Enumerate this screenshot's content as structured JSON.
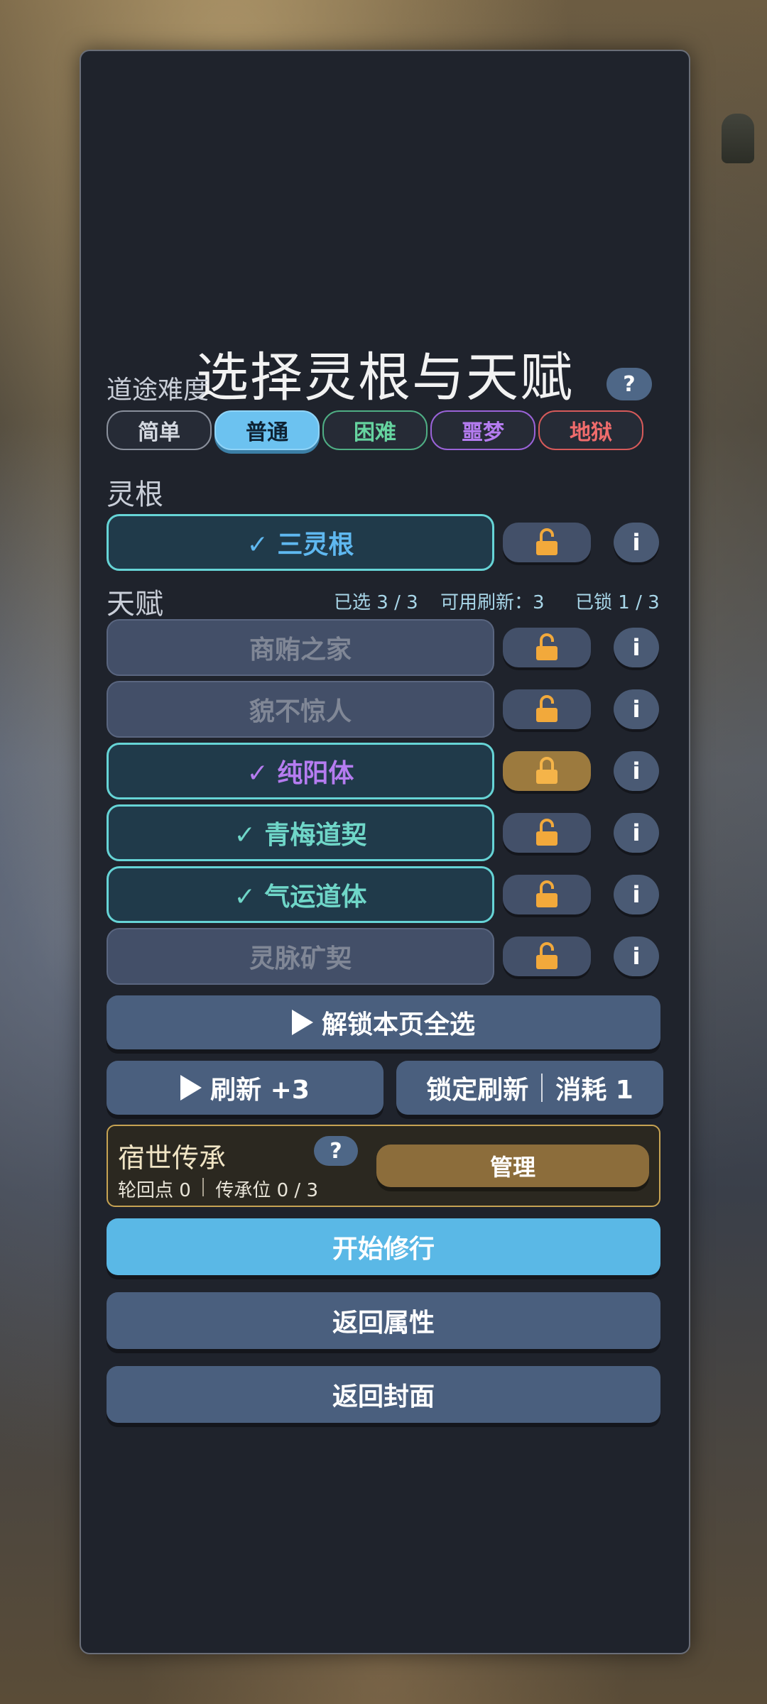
{
  "title": "选择灵根与天赋",
  "difficulty": {
    "label": "道途难度",
    "help": "?",
    "options": [
      {
        "label": "简单",
        "color": "#d4d8e0"
      },
      {
        "label": "普通",
        "color": "#0e2233"
      },
      {
        "label": "困难",
        "color": "#66d4a0"
      },
      {
        "label": "噩梦",
        "color": "#b57cf0"
      },
      {
        "label": "地狱",
        "color": "#f06c6c"
      }
    ],
    "selected": "普通"
  },
  "root": {
    "label": "灵根",
    "item": {
      "label": "✓ 三灵根",
      "selected": true,
      "locked": false,
      "color": "#5fb8f0"
    }
  },
  "talents": {
    "label": "天赋",
    "selected_count": "已选 3 / 3",
    "refresh_available": "可用刷新：3",
    "locked_count": "已锁 1 / 3",
    "items": [
      {
        "label": "商贿之家",
        "selected": false,
        "locked": false
      },
      {
        "label": "貌不惊人",
        "selected": false,
        "locked": false
      },
      {
        "label": "✓ 纯阳体",
        "selected": true,
        "locked": true,
        "color": "#b57cf0"
      },
      {
        "label": "✓ 青梅道契",
        "selected": true,
        "locked": false,
        "color": "#6fd6c8"
      },
      {
        "label": "✓ 气运道体",
        "selected": true,
        "locked": false,
        "color": "#6fd6c8"
      },
      {
        "label": "灵脉矿契",
        "selected": false,
        "locked": false
      }
    ],
    "info_label": "i"
  },
  "actions": {
    "unlock_select_all": "解锁本页全选",
    "refresh": "刷新 +3",
    "lock_refresh": "锁定刷新",
    "lock_refresh_cost": "消耗 1"
  },
  "legacy": {
    "title": "宿世传承",
    "help": "?",
    "points": "轮回点 0",
    "slots": "传承位 0 / 3",
    "manage": "管理"
  },
  "buttons": {
    "start": "开始修行",
    "back_attributes": "返回属性",
    "back_cover": "返回封面"
  },
  "colors": {
    "accent_blue": "#5ab8e6",
    "lock_gold": "#f2a93b",
    "legacy_border": "#c7a353"
  }
}
